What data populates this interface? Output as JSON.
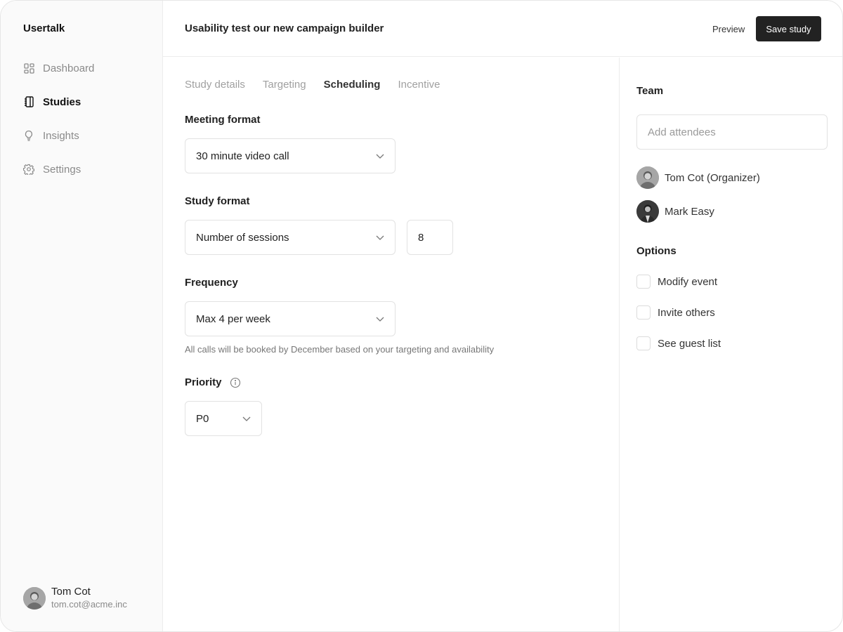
{
  "app": {
    "name": "Usertalk"
  },
  "sidebar": {
    "items": [
      {
        "label": "Dashboard",
        "icon": "dashboard-icon",
        "active": false
      },
      {
        "label": "Studies",
        "icon": "notebook-icon",
        "active": true
      },
      {
        "label": "Insights",
        "icon": "lightbulb-icon",
        "active": false
      },
      {
        "label": "Settings",
        "icon": "gear-icon",
        "active": false
      }
    ],
    "user": {
      "name": "Tom Cot",
      "email": "tom.cot@acme.inc"
    }
  },
  "header": {
    "title": "Usability test our new campaign builder",
    "preview_label": "Preview",
    "save_label": "Save study"
  },
  "tabs": [
    {
      "label": "Study details",
      "active": false
    },
    {
      "label": "Targeting",
      "active": false
    },
    {
      "label": "Scheduling",
      "active": true
    },
    {
      "label": "Incentive",
      "active": false
    }
  ],
  "form": {
    "meeting_format": {
      "label": "Meeting format",
      "value": "30 minute video call"
    },
    "study_format": {
      "label": "Study format",
      "value": "Number of sessions",
      "count": "8"
    },
    "frequency": {
      "label": "Frequency",
      "value": "Max 4 per week",
      "helper": "All calls will be booked by December based on your targeting and availability"
    },
    "priority": {
      "label": "Priority",
      "value": "P0"
    }
  },
  "team": {
    "heading": "Team",
    "input_placeholder": "Add attendees",
    "members": [
      {
        "name": "Tom Cot (Organizer)"
      },
      {
        "name": "Mark Easy"
      }
    ]
  },
  "options": {
    "heading": "Options",
    "items": [
      {
        "label": "Modify event",
        "checked": false
      },
      {
        "label": "Invite others",
        "checked": false
      },
      {
        "label": "See guest list",
        "checked": false
      }
    ]
  },
  "colors": {
    "primary_button": "#222222",
    "border": "#e2e2e2",
    "sidebar_bg": "#fafafa",
    "muted_text": "#8a8a8a"
  }
}
